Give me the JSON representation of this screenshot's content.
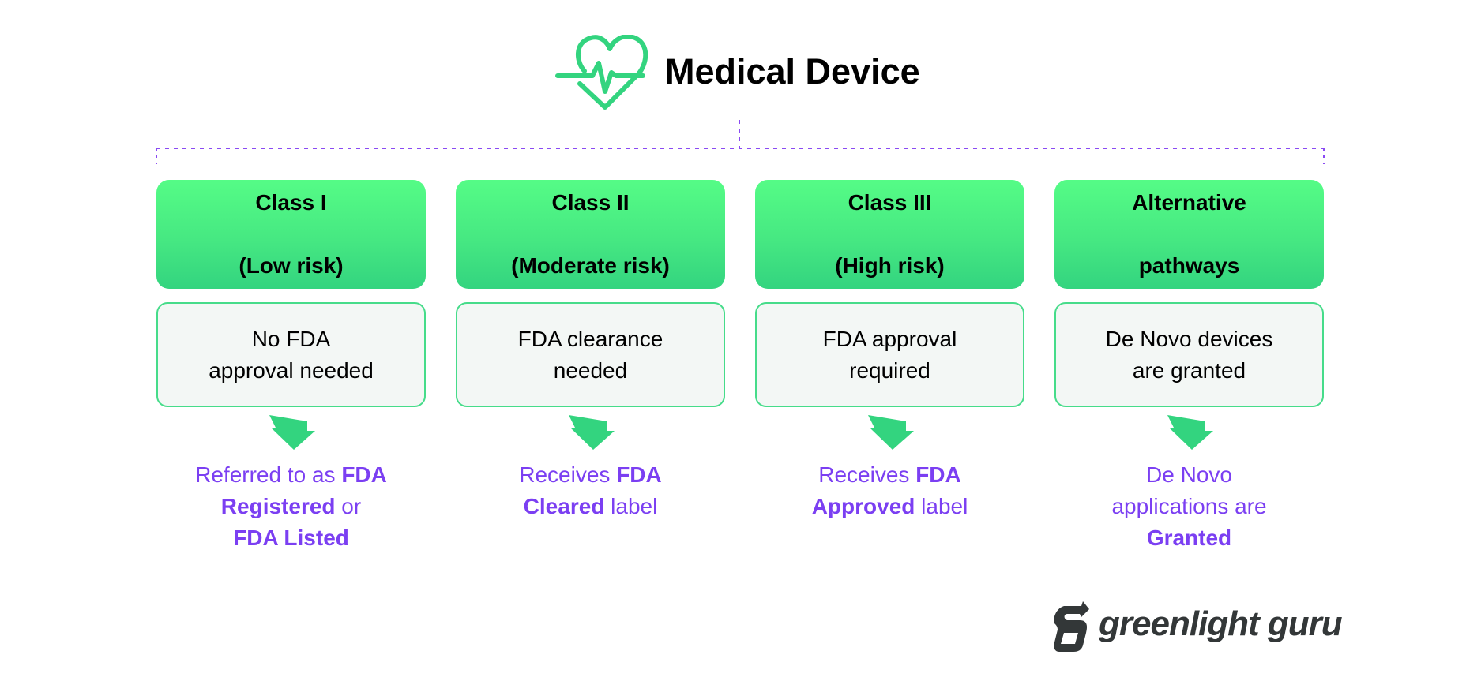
{
  "header": {
    "title": "Medical Device",
    "icon": "heart-pulse-icon"
  },
  "colors": {
    "green_top": "#55fc86",
    "green_bottom": "#33d47f",
    "box_bg": "#f3f7f5",
    "box_border": "#46dc8a",
    "purple": "#7b3ff2",
    "connector": "#8a4af3",
    "logo": "#333738"
  },
  "columns": [
    {
      "class_line1": "Class I",
      "class_line2": "(Low risk)",
      "requirement_line1": "No FDA",
      "requirement_line2": "approval needed",
      "result_lines": [
        [
          {
            "text": "Referred to as ",
            "bold": false
          },
          {
            "text": "FDA",
            "bold": true
          }
        ],
        [
          {
            "text": "Registered",
            "bold": true
          },
          {
            "text": " or",
            "bold": false
          }
        ],
        [
          {
            "text": "FDA Listed",
            "bold": true
          }
        ]
      ]
    },
    {
      "class_line1": "Class II",
      "class_line2": "(Moderate risk)",
      "requirement_line1": "FDA clearance",
      "requirement_line2": "needed",
      "result_lines": [
        [
          {
            "text": "Receives ",
            "bold": false
          },
          {
            "text": "FDA",
            "bold": true
          }
        ],
        [
          {
            "text": "Cleared",
            "bold": true
          },
          {
            "text": " label",
            "bold": false
          }
        ]
      ]
    },
    {
      "class_line1": "Class III",
      "class_line2": "(High risk)",
      "requirement_line1": "FDA approval",
      "requirement_line2": "required",
      "result_lines": [
        [
          {
            "text": "Receives ",
            "bold": false
          },
          {
            "text": "FDA",
            "bold": true
          }
        ],
        [
          {
            "text": "Approved",
            "bold": true
          },
          {
            "text": " label",
            "bold": false
          }
        ]
      ]
    },
    {
      "class_line1": "Alternative",
      "class_line2": "pathways",
      "requirement_line1": "De Novo devices",
      "requirement_line2": "are granted",
      "result_lines": [
        [
          {
            "text": "De Novo",
            "bold": false
          }
        ],
        [
          {
            "text": "applications are",
            "bold": false
          }
        ],
        [
          {
            "text": "Granted",
            "bold": true
          }
        ]
      ]
    }
  ],
  "logo": {
    "text": "greenlight guru",
    "icon": "greenlight-guru-logo-icon"
  }
}
